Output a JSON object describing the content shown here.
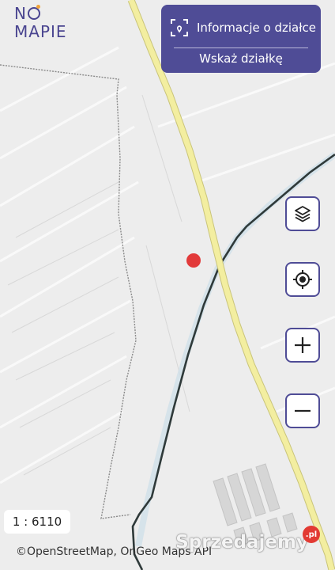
{
  "logo": {
    "line1_a": "N",
    "line1_b": "",
    "line2": "MAPIE"
  },
  "panel": {
    "parcel_info_label": "Informacje o działce",
    "point_parcel_label": "Wskaż działkę"
  },
  "controls": [
    {
      "name": "layers-button",
      "icon": "layers-icon"
    },
    {
      "name": "locate-button",
      "icon": "crosshair-icon"
    },
    {
      "name": "zoom-in-button",
      "icon": "plus-icon"
    },
    {
      "name": "zoom-out-button",
      "icon": "minus-icon"
    }
  ],
  "scale": {
    "label": "1 : 6110"
  },
  "attribution": {
    "text": "©OpenStreetMap, OnGeo Maps API"
  },
  "watermark": {
    "text": "Sprzedajemy",
    "badge": ".pl"
  },
  "colors": {
    "accent": "#4f4c96",
    "road": "#f3eea0",
    "marker": "#e23a3a",
    "river": "#2f3a3a"
  }
}
